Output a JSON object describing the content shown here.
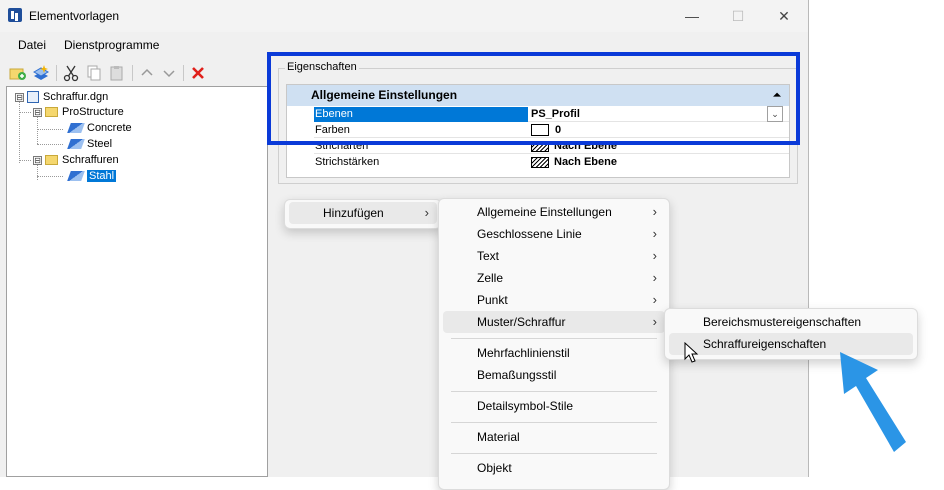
{
  "window": {
    "title": "Elementvorlagen",
    "minimize": "—",
    "maximize": "☐",
    "close": "✕"
  },
  "menubar": {
    "items": [
      "Datei",
      "Dienstprogramme"
    ]
  },
  "toolbar": {
    "icons": [
      "new-folder-icon",
      "new-template-icon",
      "cut-icon",
      "copy-icon",
      "paste-icon",
      "move-up-icon",
      "move-down-icon",
      "delete-icon"
    ]
  },
  "tree": {
    "root": {
      "label": "Schraffur.dgn",
      "expander": "⊟"
    },
    "nodes": [
      {
        "label": "ProStructure",
        "expander": "⊟"
      },
      {
        "label": "Concrete"
      },
      {
        "label": "Steel"
      },
      {
        "label": "Schraffuren",
        "expander": "⊟"
      },
      {
        "label": "Stahl"
      }
    ]
  },
  "properties": {
    "group_label": "Eigenschaften",
    "header": "Allgemeine Einstellungen",
    "collapse": "⏶",
    "rows": [
      {
        "key": "Ebenen",
        "value": "PS_Profil"
      },
      {
        "key": "Farben",
        "value": "0"
      },
      {
        "key": "Stricharten",
        "value": "Nach Ebene"
      },
      {
        "key": "Strichstärken",
        "value": "Nach Ebene"
      }
    ],
    "dropdown": "⌄"
  },
  "context_menu": {
    "root": {
      "label": "Hinzufügen",
      "arrow": "›"
    },
    "sub": [
      {
        "label": "Allgemeine Einstellungen",
        "arrow": "›"
      },
      {
        "label": "Geschlossene Linie",
        "arrow": "›"
      },
      {
        "label": "Text",
        "arrow": "›"
      },
      {
        "label": "Zelle",
        "arrow": "›"
      },
      {
        "label": "Punkt",
        "arrow": "›"
      },
      {
        "label": "Muster/Schraffur",
        "arrow": "›"
      },
      {
        "label": "Mehrfachlinienstil"
      },
      {
        "label": "Bemaßungsstil"
      },
      {
        "label": "Detailsymbol-Stile"
      },
      {
        "label": "Material"
      },
      {
        "label": "Objekt"
      }
    ],
    "sub2": [
      {
        "label": "Bereichsmustereigenschaften"
      },
      {
        "label": "Schraffureigenschaften"
      }
    ]
  },
  "colors": {
    "highlight_box": "#0a3ad8",
    "annotation_arrow": "#2b95e6",
    "selection": "#0078d7"
  }
}
